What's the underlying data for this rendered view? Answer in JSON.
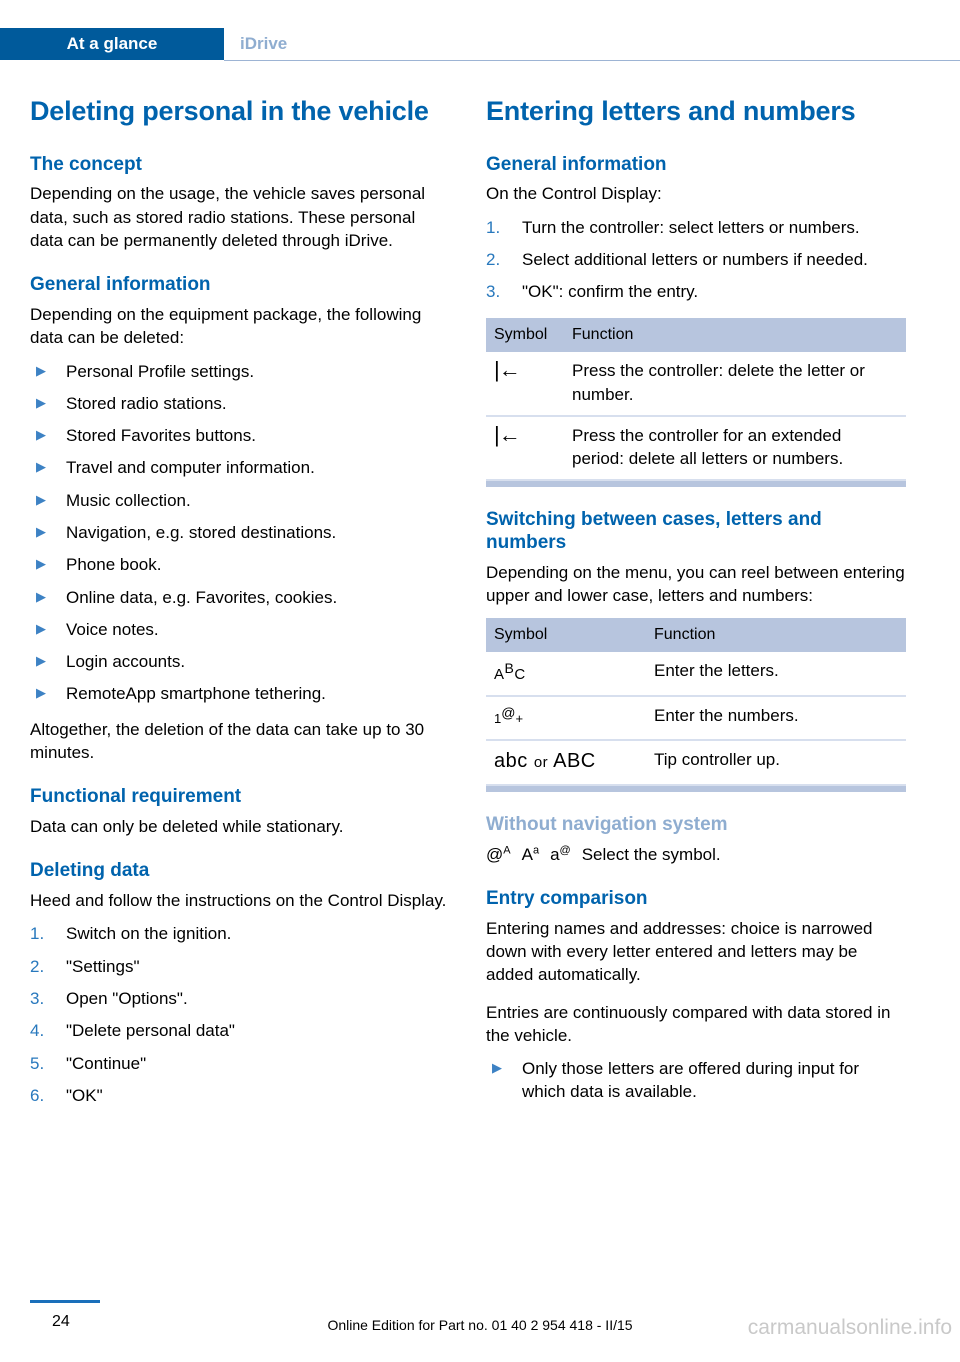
{
  "header": {
    "active_tab": "At a glance",
    "inactive_tab": "iDrive"
  },
  "left_column": {
    "title": "Deleting personal in the vehicle",
    "sections": [
      {
        "heading": "The concept",
        "paragraph": "Depending on the usage, the vehicle saves personal data, such as stored radio stations. These personal data can be permanently deleted through iDrive."
      },
      {
        "heading": "General information",
        "paragraph": "Depending on the equipment package, the following data can be deleted:",
        "bullets": [
          "Personal Profile settings.",
          "Stored radio stations.",
          "Stored Favorites buttons.",
          "Travel and computer information.",
          "Music collection.",
          "Navigation, e.g. stored destinations.",
          "Phone book.",
          "Online data, e.g. Favorites, cookies.",
          "Voice notes.",
          "Login accounts.",
          "RemoteApp smartphone tethering."
        ],
        "closing": "Altogether, the deletion of the data can take up to 30 minutes."
      },
      {
        "heading": "Functional requirement",
        "paragraph": "Data can only be deleted while stationary."
      },
      {
        "heading": "Deleting data",
        "paragraph": "Heed and follow the instructions on the Control Display.",
        "steps": [
          {
            "n": "1.",
            "text": "Switch on the ignition."
          },
          {
            "n": "2.",
            "text": "\"Settings\""
          },
          {
            "n": "3.",
            "text": "Open \"Options\"."
          },
          {
            "n": "4.",
            "text": "\"Delete personal data\""
          },
          {
            "n": "5.",
            "text": "\"Continue\""
          },
          {
            "n": "6.",
            "text": "\"OK\""
          }
        ]
      }
    ]
  },
  "right_column": {
    "title": "Entering letters and numbers",
    "general": {
      "heading": "General information",
      "paragraph": "On the Control Display:",
      "steps": [
        {
          "n": "1.",
          "text": "Turn the controller: select letters or numbers."
        },
        {
          "n": "2.",
          "text": "Select additional letters or numbers if needed."
        },
        {
          "n": "3.",
          "text": "\"OK\": confirm the entry."
        }
      ]
    },
    "table_delete": {
      "columns": [
        "Symbol",
        "Function"
      ],
      "rows": [
        {
          "symbol": "backspace-icon",
          "function": "Press the controller: delete the letter or number."
        },
        {
          "symbol": "backspace-icon",
          "function": "Press the controller for an extended period: delete all letters or numbers."
        }
      ]
    },
    "switching": {
      "heading": "Switching between cases, letters and numbers",
      "paragraph": "Depending on the menu, you can reel between entering upper and lower case, letters and numbers:"
    },
    "table_switching": {
      "columns": [
        "Symbol",
        "Function"
      ],
      "rows": [
        {
          "symbol_a": "A",
          "symbol_b": "B",
          "symbol_c": "C",
          "function": "Enter the letters."
        },
        {
          "symbol_a": "1",
          "symbol_b": "@",
          "symbol_c": "+",
          "function": "Enter the numbers."
        },
        {
          "symbol_a": "abc",
          "symbol_b": "or",
          "symbol_c": "ABC",
          "function": "Tip controller up."
        }
      ]
    },
    "without_nav": {
      "heading": "Without navigation system",
      "symbols": [
        {
          "base": "@",
          "sup": "A"
        },
        {
          "base": "A",
          "sup": "a"
        },
        {
          "base": "a",
          "sup": "@"
        }
      ],
      "text": "Select the symbol."
    },
    "entry_comparison": {
      "heading": "Entry comparison",
      "paragraph1": "Entering names and addresses: choice is narrowed down with every letter entered and letters may be added automatically.",
      "paragraph2": "Entries are continuously compared with data stored in the vehicle.",
      "bullets": [
        "Only those letters are offered during input for which data is available."
      ]
    }
  },
  "footer": {
    "page_number": "24",
    "edition_text": "Online Edition for Part no. 01 40 2 954 418 - II/15",
    "watermark": "carmanualsonline.info"
  },
  "colors": {
    "brand_blue": "#005a9b",
    "heading_blue": "#0063ad",
    "light_blue": "#8fadd0",
    "table_header": "#b7c5de",
    "table_rule": "#d7dfee",
    "bullet_blue": "#3d82c4"
  }
}
